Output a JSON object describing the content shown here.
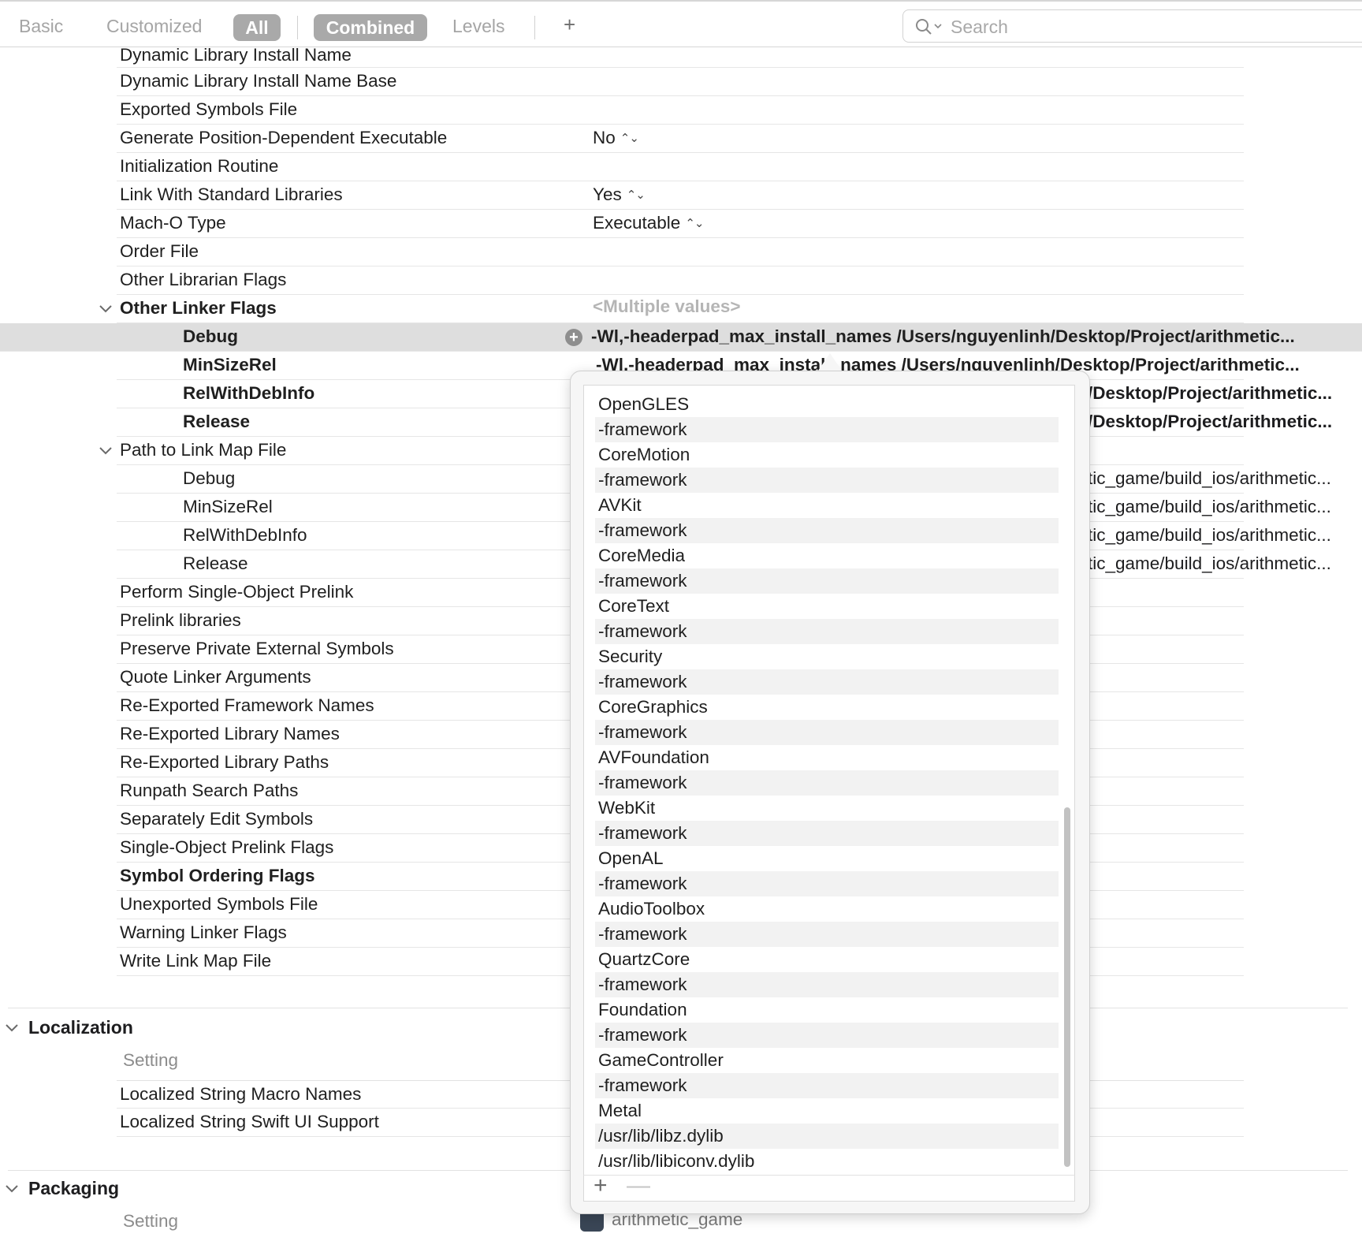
{
  "toolbar": {
    "basic": "Basic",
    "customized": "Customized",
    "all": "All",
    "combined": "Combined",
    "levels": "Levels",
    "add": "+",
    "search_placeholder": "Search"
  },
  "rows": [
    {
      "name": "Dynamic Library Install Name",
      "value": ""
    },
    {
      "name": "Dynamic Library Install Name Base",
      "value": ""
    },
    {
      "name": "Exported Symbols File",
      "value": ""
    },
    {
      "name": "Generate Position-Dependent Executable",
      "value": "No"
    },
    {
      "name": "Initialization Routine",
      "value": ""
    },
    {
      "name": "Link With Standard Libraries",
      "value": "Yes"
    },
    {
      "name": "Mach-O Type",
      "value": "Executable"
    },
    {
      "name": "Order File",
      "value": ""
    },
    {
      "name": "Other Librarian Flags",
      "value": ""
    }
  ],
  "other_linker_flags": {
    "name": "Other Linker Flags",
    "value": "<Multiple values>",
    "debug": {
      "name": "Debug",
      "value": "-Wl,-headerpad_max_install_names /Users/nguyenlinh/Desktop/Project/arithmetic..."
    },
    "minsizerel": {
      "name": "MinSizeRel",
      "value": "-Wl,-headerpad_max_install_names /Users/nguyenlinh/Desktop/Project/arithmetic..."
    },
    "relwithdebinfo": {
      "name": "RelWithDebInfo",
      "value": "/Desktop/Project/arithmetic..."
    },
    "release": {
      "name": "Release",
      "value": "/Desktop/Project/arithmetic..."
    }
  },
  "link_map": {
    "name": "Path to Link Map File",
    "debug": {
      "name": "Debug",
      "value": "tic_game/build_ios/arithmetic..."
    },
    "minsizerel": {
      "name": "MinSizeRel",
      "value": "tic_game/build_ios/arithmetic..."
    },
    "relwithdebinfo": {
      "name": "RelWithDebInfo",
      "value": "tic_game/build_ios/arithmetic..."
    },
    "release": {
      "name": "Release",
      "value": "tic_game/build_ios/arithmetic..."
    }
  },
  "rows2": [
    "Perform Single-Object Prelink",
    "Prelink libraries",
    "Preserve Private External Symbols",
    "Quote Linker Arguments",
    "Re-Exported Framework Names",
    "Re-Exported Library Names",
    "Re-Exported Library Paths",
    "Runpath Search Paths",
    "Separately Edit Symbols",
    "Single-Object Prelink Flags",
    "Symbol Ordering Flags",
    "Unexported Symbols File",
    "Warning Linker Flags",
    "Write Link Map File"
  ],
  "localization": {
    "title": "Localization",
    "setting_label": "Setting",
    "rows": [
      "Localized String Macro Names",
      "Localized String Swift UI Support"
    ]
  },
  "packaging": {
    "title": "Packaging",
    "setting_label": "Setting",
    "target": "arithmetic_game"
  },
  "popover_items": [
    "OpenGLES",
    "-framework",
    "CoreMotion",
    "-framework",
    "AVKit",
    "-framework",
    "CoreMedia",
    "-framework",
    "CoreText",
    "-framework",
    "Security",
    "-framework",
    "CoreGraphics",
    "-framework",
    "AVFoundation",
    "-framework",
    "WebKit",
    "-framework",
    "OpenAL",
    "-framework",
    "AudioToolbox",
    "-framework",
    "QuartzCore",
    "-framework",
    "Foundation",
    "-framework",
    "GameController",
    "-framework",
    "Metal",
    "/usr/lib/libz.dylib",
    "/usr/lib/libiconv.dylib"
  ],
  "popover_footer": {
    "add": "+",
    "remove": "—"
  }
}
